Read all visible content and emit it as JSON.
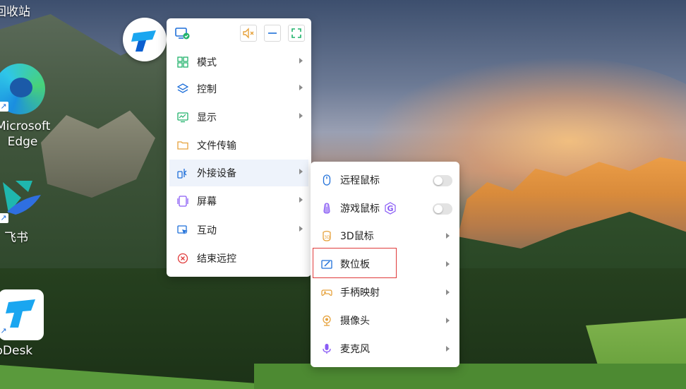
{
  "desktop": {
    "icons": [
      {
        "name": "recycle-bin",
        "label": "回收站"
      },
      {
        "name": "edge",
        "label_line1": "Microsoft",
        "label_line2": "Edge"
      },
      {
        "name": "feishu",
        "label": "飞书"
      },
      {
        "name": "todesk",
        "label": "ToDesk"
      }
    ]
  },
  "toolbar": {
    "colors": {
      "screen": "#1e6fd9",
      "mute": "#e6a23c",
      "minimize": "#1e6fd9",
      "fullscreen": "#20b26b"
    }
  },
  "menu": {
    "items": [
      {
        "label": "模式",
        "icon": "grid-icon",
        "has_submenu": true
      },
      {
        "label": "控制",
        "icon": "layers-icon",
        "has_submenu": true
      },
      {
        "label": "显示",
        "icon": "monitor-icon",
        "has_submenu": true
      },
      {
        "label": "文件传输",
        "icon": "folder-icon",
        "has_submenu": false
      },
      {
        "label": "外接设备",
        "icon": "peripheral-icon",
        "has_submenu": true,
        "active": true
      },
      {
        "label": "屏幕",
        "icon": "screen-icon",
        "has_submenu": true
      },
      {
        "label": "互动",
        "icon": "chat-icon",
        "has_submenu": true
      },
      {
        "label": "结束远控",
        "icon": "close-circle-icon",
        "has_submenu": false
      }
    ]
  },
  "submenu": {
    "items": [
      {
        "label": "远程鼠标",
        "icon": "mouse-icon",
        "control": "toggle",
        "on": false
      },
      {
        "label": "游戏鼠标",
        "icon": "game-mouse-icon",
        "badge": "G",
        "control": "toggle",
        "on": false
      },
      {
        "label": "3D鼠标",
        "icon": "3d-mouse-icon",
        "control": "arrow"
      },
      {
        "label": "数位板",
        "icon": "tablet-icon",
        "control": "arrow",
        "highlighted": true
      },
      {
        "label": "手柄映射",
        "icon": "gamepad-icon",
        "control": "arrow"
      },
      {
        "label": "摄像头",
        "icon": "camera-icon",
        "control": "arrow"
      },
      {
        "label": "麦克风",
        "icon": "microphone-icon",
        "control": "arrow"
      }
    ]
  }
}
